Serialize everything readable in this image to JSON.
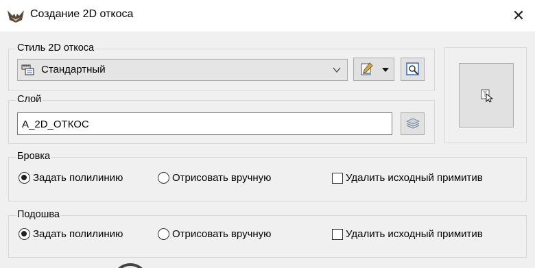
{
  "window": {
    "title": "Создание 2D откоса",
    "close_glyph": "✕",
    "app_icon": "bat-logo-icon"
  },
  "style_group": {
    "label": "Стиль 2D откоса",
    "combo_value": "Стандартный",
    "combo_icon": "style-ruler-icon",
    "edit_button_icon": "edit-style-icon",
    "preview_button_icon": "preview-icon"
  },
  "layer_group": {
    "label": "Слой",
    "value": "A_2D_ОТКОС",
    "layers_button_icon": "layers-icon"
  },
  "pick_button_icon": "pick-object-icon",
  "brovka_group": {
    "label": "Бровка",
    "options": [
      "Задать полилинию",
      "Отрисовать вручную"
    ],
    "selected": "Задать полилинию",
    "delete_source_label": "Удалить исходный примитив",
    "delete_source_checked": false
  },
  "podoshva_group": {
    "label": "Подошва",
    "options": [
      "Задать полилинию",
      "Отрисовать вручную"
    ],
    "selected": "Задать полилинию",
    "delete_source_label": "Удалить исходный примитив",
    "delete_source_checked": false
  },
  "colors": {
    "titlebar_bg": "#ffffff",
    "dialog_bg": "#f0f0f0",
    "group_border": "#d6d6d6",
    "button_bg": "#e1e1e1",
    "accent_blue": "#2f6fc2"
  }
}
